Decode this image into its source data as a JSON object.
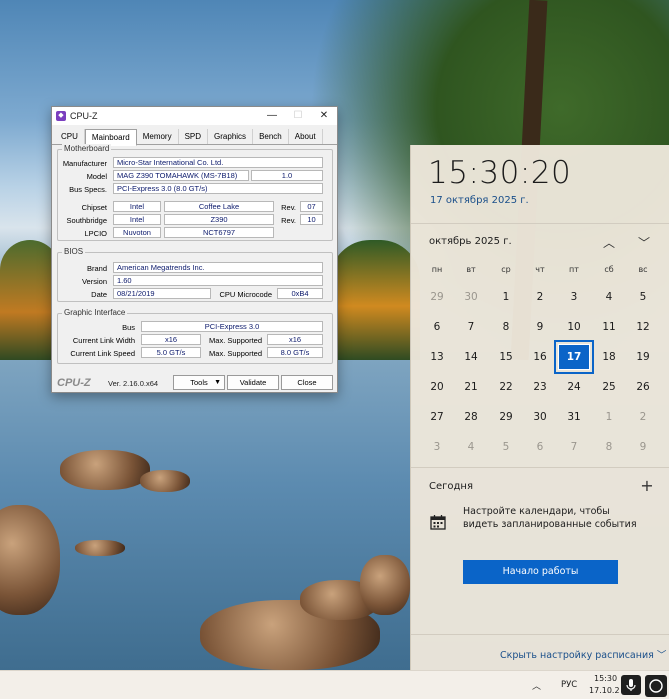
{
  "cpuz": {
    "title": "CPU-Z",
    "app_icon": "cpuz-logo-icon",
    "window_buttons": {
      "minimize": "—",
      "maximize": "☐",
      "close": "✕"
    },
    "tabs": [
      "CPU",
      "Mainboard",
      "Memory",
      "SPD",
      "Graphics",
      "Bench",
      "About"
    ],
    "active_tab": "Mainboard",
    "motherboard": {
      "title": "Motherboard",
      "manufacturer_label": "Manufacturer",
      "manufacturer": "Micro-Star International Co. Ltd.",
      "model_label": "Model",
      "model": "MAG Z390 TOMAHAWK (MS-7B18)",
      "model_rev": "1.0",
      "bus_label": "Bus Specs.",
      "bus": "PCI-Express 3.0 (8.0 GT/s)",
      "chipset_label": "Chipset",
      "chipset_vendor": "Intel",
      "chipset_name": "Coffee Lake",
      "chipset_rev_label": "Rev.",
      "chipset_rev": "07",
      "southbridge_label": "Southbridge",
      "southbridge_vendor": "Intel",
      "southbridge_name": "Z390",
      "southbridge_rev_label": "Rev.",
      "southbridge_rev": "10",
      "lpcio_label": "LPCIO",
      "lpcio_vendor": "Nuvoton",
      "lpcio_name": "NCT6797"
    },
    "bios": {
      "title": "BIOS",
      "brand_label": "Brand",
      "brand": "American Megatrends Inc.",
      "version_label": "Version",
      "version": "1.60",
      "date_label": "Date",
      "date": "08/21/2019",
      "microcode_label": "CPU Microcode",
      "microcode": "0xB4"
    },
    "graphic": {
      "title": "Graphic Interface",
      "bus_label": "Bus",
      "bus": "PCI-Express 3.0",
      "link_width_label": "Current Link Width",
      "link_width": "x16",
      "max_width_label": "Max. Supported",
      "max_width": "x16",
      "link_speed_label": "Current Link Speed",
      "link_speed": "5.0 GT/s",
      "max_speed_label": "Max. Supported",
      "max_speed": "8.0 GT/s"
    },
    "footer": {
      "logo": "CPU-Z",
      "version": "Ver. 2.16.0.x64",
      "tools_label": "Tools",
      "validate_label": "Validate",
      "close_label": "Close"
    }
  },
  "calendar": {
    "time": "15:30:20",
    "date": "17 октября 2025 г.",
    "month": "октябрь 2025 г.",
    "nav_up": "︿",
    "nav_down": "﹀",
    "weekdays": [
      "пн",
      "вт",
      "ср",
      "чт",
      "пт",
      "сб",
      "вс"
    ],
    "weeks": [
      [
        "29",
        "30",
        "1",
        "2",
        "3",
        "4",
        "5"
      ],
      [
        "6",
        "7",
        "8",
        "9",
        "10",
        "11",
        "12"
      ],
      [
        "13",
        "14",
        "15",
        "16",
        "17",
        "18",
        "19"
      ],
      [
        "20",
        "21",
        "22",
        "23",
        "24",
        "25",
        "26"
      ],
      [
        "27",
        "28",
        "29",
        "30",
        "31",
        "1",
        "2"
      ],
      [
        "3",
        "4",
        "5",
        "6",
        "7",
        "8",
        "9"
      ]
    ],
    "today": "17",
    "agenda_title": "Сегодня",
    "add_symbol": "+",
    "agenda_message": "Настройте календари, чтобы видеть запланированные события",
    "start_button": "Начало работы",
    "hide_link": "Скрыть настройку расписания ﹀"
  },
  "taskbar": {
    "chevron": "︿",
    "language": "РУС",
    "time": "15:30",
    "date": "17.10.2025"
  }
}
